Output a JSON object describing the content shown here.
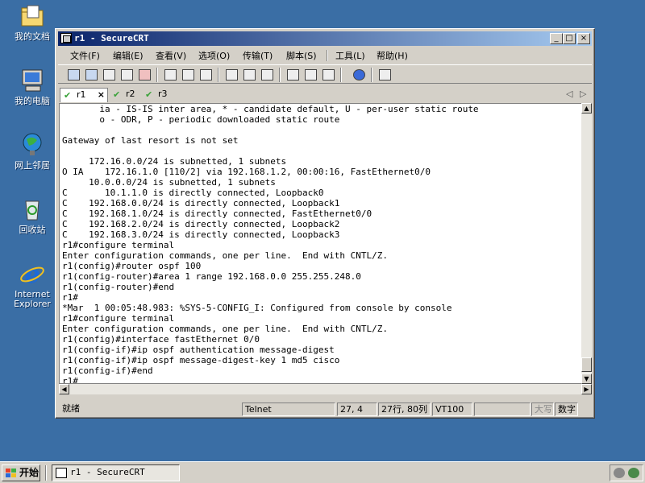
{
  "desktop": {
    "icons": [
      {
        "label": "我的文档",
        "icon": "folder-icon"
      },
      {
        "label": "我的电脑",
        "icon": "computer-icon"
      },
      {
        "label": "网上邻居",
        "icon": "network-icon"
      },
      {
        "label": "回收站",
        "icon": "recycle-bin-icon"
      },
      {
        "label": "Internet Explorer",
        "icon": "ie-icon"
      }
    ]
  },
  "window": {
    "title": "r1 - SecureCRT",
    "controls": {
      "minimize": "_",
      "maximize": "□",
      "close": "×"
    },
    "menu": [
      "文件(F)",
      "编辑(E)",
      "查看(V)",
      "选项(O)",
      "传输(T)",
      "脚本(S)",
      "工具(L)",
      "帮助(H)"
    ],
    "tabs": [
      {
        "label": "r1",
        "active": true,
        "close": "×"
      },
      {
        "label": "r2",
        "active": false
      },
      {
        "label": "r3",
        "active": false
      }
    ],
    "terminal_lines": [
      "       ia - IS-IS inter area, * - candidate default, U - per-user static route",
      "       o - ODR, P - periodic downloaded static route",
      "",
      "Gateway of last resort is not set",
      "",
      "     172.16.0.0/24 is subnetted, 1 subnets",
      "O IA    172.16.1.0 [110/2] via 192.168.1.2, 00:00:16, FastEthernet0/0",
      "     10.0.0.0/24 is subnetted, 1 subnets",
      "C       10.1.1.0 is directly connected, Loopback0",
      "C    192.168.0.0/24 is directly connected, Loopback1",
      "C    192.168.1.0/24 is directly connected, FastEthernet0/0",
      "C    192.168.2.0/24 is directly connected, Loopback2",
      "C    192.168.3.0/24 is directly connected, Loopback3",
      "r1#configure terminal",
      "Enter configuration commands, one per line.  End with CNTL/Z.",
      "r1(config)#router ospf 100",
      "r1(config-router)#area 1 range 192.168.0.0 255.255.248.0",
      "r1(config-router)#end",
      "r1#",
      "*Mar  1 00:05:48.983: %SYS-5-CONFIG_I: Configured from console by console",
      "r1#configure terminal",
      "Enter configuration commands, one per line.  End with CNTL/Z.",
      "r1(config)#interface fastEthernet 0/0",
      "r1(config-if)#ip ospf authentication message-digest",
      "r1(config-if)#ip ospf message-digest-key 1 md5 cisco",
      "r1(config-if)#end",
      "r1#"
    ],
    "status": {
      "ready": "就绪",
      "protocol": "Telnet",
      "cursor": "27,  4",
      "size": "27行, 80列",
      "emulation": "VT100",
      "caps": "大写",
      "num": "数字"
    }
  },
  "taskbar": {
    "start": "开始",
    "task": "r1 - SecureCRT"
  }
}
